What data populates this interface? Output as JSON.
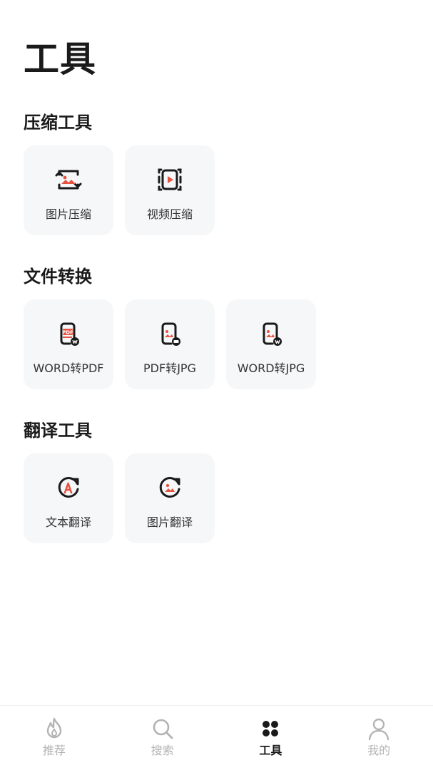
{
  "page": {
    "title": "工具"
  },
  "sections": [
    {
      "title": "压缩工具",
      "items": [
        {
          "label": "图片压缩",
          "icon": "image-compress-icon"
        },
        {
          "label": "视频压缩",
          "icon": "video-compress-icon"
        }
      ]
    },
    {
      "title": "文件转换",
      "items": [
        {
          "label": "WORD转PDF",
          "icon": "word-to-pdf-icon",
          "badge": "PDF"
        },
        {
          "label": "PDF转JPG",
          "icon": "pdf-to-jpg-icon"
        },
        {
          "label": "WORD转JPG",
          "icon": "word-to-jpg-icon"
        }
      ]
    },
    {
      "title": "翻译工具",
      "items": [
        {
          "label": "文本翻译",
          "icon": "text-translate-icon"
        },
        {
          "label": "图片翻译",
          "icon": "image-translate-icon"
        }
      ]
    }
  ],
  "tabbar": {
    "items": [
      {
        "label": "推荐",
        "icon": "flame-icon",
        "active": false
      },
      {
        "label": "搜索",
        "icon": "search-icon",
        "active": false
      },
      {
        "label": "工具",
        "icon": "grid-dots-icon",
        "active": true
      },
      {
        "label": "我的",
        "icon": "user-icon",
        "active": false
      }
    ]
  },
  "colors": {
    "accent": "#e8533f",
    "text": "#1a1a1a",
    "tile_bg": "#f6f7f8",
    "tab_inactive": "#b3b3b3"
  }
}
